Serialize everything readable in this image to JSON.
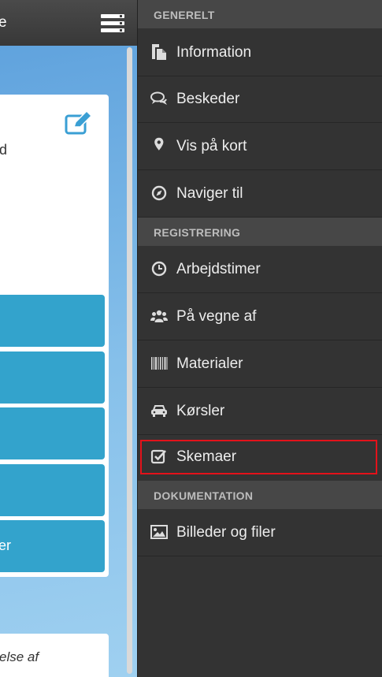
{
  "app": {
    "header_title": "e",
    "card_text": "d",
    "buttons": [
      "",
      "",
      "",
      "",
      "er"
    ],
    "card2_text": "else af"
  },
  "menu": {
    "sections": {
      "generelt": "GENERELT",
      "registrering": "REGISTRERING",
      "dokumentation": "DOKUMENTATION"
    },
    "items": [
      {
        "label": "Information",
        "icon": "document-icon"
      },
      {
        "label": "Beskeder",
        "icon": "chat-icon"
      },
      {
        "label": "Vis på kort",
        "icon": "map-pin-icon"
      },
      {
        "label": "Naviger til",
        "icon": "compass-icon"
      },
      {
        "label": "Arbejdstimer",
        "icon": "clock-icon"
      },
      {
        "label": "På vegne af",
        "icon": "group-icon"
      },
      {
        "label": "Materialer",
        "icon": "barcode-icon"
      },
      {
        "label": "Kørsler",
        "icon": "car-icon"
      },
      {
        "label": "Skemaer",
        "icon": "checkbox-icon"
      },
      {
        "label": "Billeder og filer",
        "icon": "image-icon"
      }
    ],
    "highlight_color": "#e3121a"
  }
}
